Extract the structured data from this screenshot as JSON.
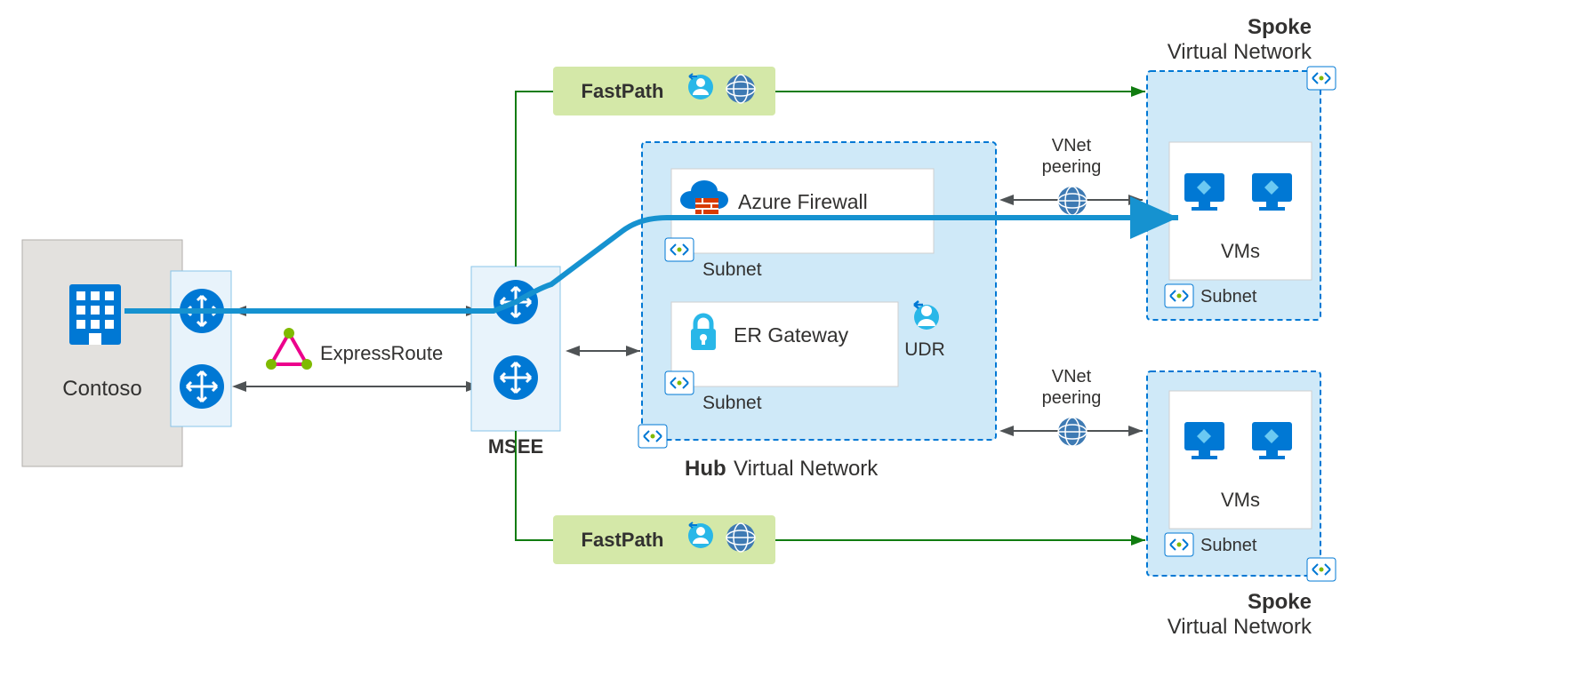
{
  "contoso": {
    "label": "Contoso"
  },
  "msee": {
    "label": "MSEE"
  },
  "expressroute": {
    "label": "ExpressRoute"
  },
  "fastpath1": {
    "label": "FastPath"
  },
  "fastpath2": {
    "label": "FastPath"
  },
  "hub": {
    "title_bold": "Hub",
    "title_rest": "Virtual Network",
    "firewall": {
      "label": "Azure Firewall",
      "subnet": "Subnet"
    },
    "gateway": {
      "label": "ER Gateway",
      "subnet": "Subnet",
      "udr": "UDR"
    }
  },
  "spoke1": {
    "title_bold": "Spoke",
    "title_rest": "Virtual Network",
    "vms": "VMs",
    "subnet": "Subnet",
    "peering": "VNet\npeering"
  },
  "spoke2": {
    "title_bold": "Spoke",
    "title_rest": "Virtual Network",
    "vms": "VMs",
    "subnet": "Subnet",
    "peering": "VNet\npeering"
  },
  "colors": {
    "azure_blue": "#0078d4",
    "light_blue_fill": "#cfe9f8",
    "pale_blue": "#e8f3fb",
    "green_line": "#107c10",
    "green_fill": "#d4e8a8",
    "grey_border": "#a6a6a6",
    "grey_arrow": "#4f5355",
    "contoso_grey": "#e3e1de"
  }
}
